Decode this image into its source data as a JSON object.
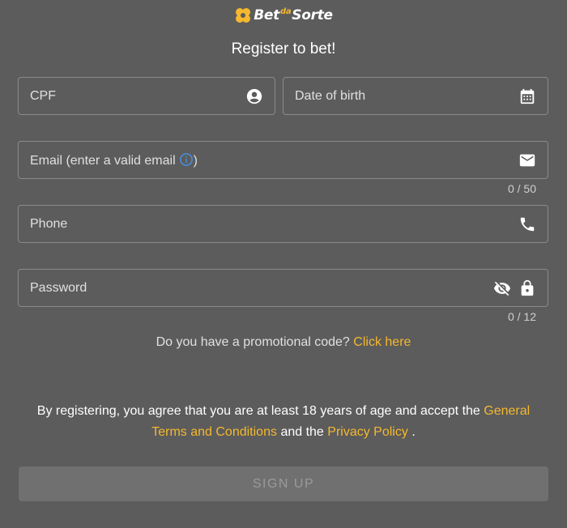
{
  "logo": {
    "text_bet": "Bet",
    "text_da": "da",
    "text_sorte": "Sorte"
  },
  "title": "Register to bet!",
  "fields": {
    "cpf": {
      "label": "CPF",
      "icon": "account-circle-icon"
    },
    "dob": {
      "label": "Date of birth",
      "icon": "calendar-icon"
    },
    "email": {
      "label": "Email (enter a valid email",
      "label_end": ")",
      "icon": "mail-icon",
      "info_icon": "info-icon",
      "counter": "0 / 50"
    },
    "phone": {
      "label": "Phone",
      "icon": "phone-icon"
    },
    "password": {
      "label": "Password",
      "icons": [
        "eye-off-icon",
        "lock-icon"
      ],
      "counter": "0 / 12"
    }
  },
  "promo": {
    "question": "Do you have a promotional code?",
    "link": "Click here"
  },
  "terms": {
    "prefix": "By registering, you agree that you are at least 18 years of age and accept the",
    "terms_link": "General Terms and Conditions",
    "middle": "and the",
    "privacy_link": "Privacy Policy",
    "suffix": "."
  },
  "signup_label": "SIGN UP",
  "colors": {
    "background": "#5c5c5c",
    "accent": "#f5b82e",
    "info": "#4a90e2",
    "button": "#707070"
  }
}
